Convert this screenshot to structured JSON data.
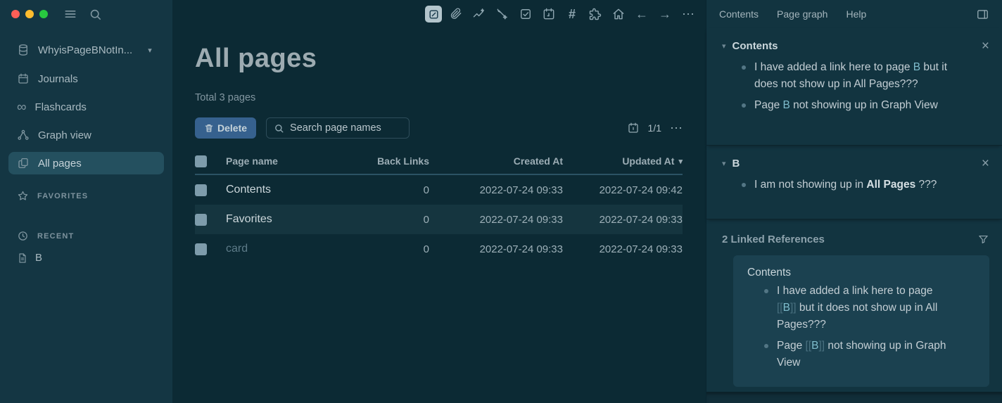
{
  "glyphs": {
    "caret_down": "▾",
    "close": "×",
    "ellipsis": "⋯",
    "arrow_left": "←",
    "arrow_right": "→",
    "hash": "#",
    "infinity": "∞"
  },
  "colors": {
    "left_sidebar_bg": "#143643",
    "main_bg": "#0c2a34",
    "right_sidebar_bg": "#123440",
    "card_bg": "#1b4150",
    "selected_item_bg": "#24505f",
    "delete_button_bg": "#36618e",
    "link_teal": "#7fbdcd",
    "traffic_red": "#ff5f57",
    "traffic_yellow": "#febc2e",
    "traffic_green": "#28c840"
  },
  "left_sidebar": {
    "graph_switcher": {
      "label": "WhyisPageBNotIn...",
      "icon": "database-icon"
    },
    "nav_items": [
      {
        "label": "Journals",
        "icon": "calendar-icon"
      },
      {
        "label": "Flashcards",
        "icon": "infinity-icon"
      },
      {
        "label": "Graph view",
        "icon": "graph-icon"
      },
      {
        "label": "All pages",
        "icon": "pages-icon"
      }
    ],
    "favorites_label": "FAVORITES",
    "recent_label": "RECENT",
    "recent_items": [
      {
        "label": "B",
        "icon": "document-icon"
      }
    ]
  },
  "toolbar": {
    "icons": [
      "edit-icon",
      "paperclip-icon",
      "activity-icon",
      "draw-icon",
      "task-icon",
      "calendar-icon",
      "hash-icon",
      "plugins-icon",
      "home-icon",
      "back-icon",
      "forward-icon",
      "more-icon"
    ]
  },
  "main": {
    "title": "All pages",
    "subtitle": "Total 3 pages",
    "delete_button": "Delete",
    "search_placeholder": "Search page names",
    "page_indicator": "1/1",
    "table": {
      "headers": {
        "name": "Page name",
        "back_links": "Back Links",
        "created": "Created At",
        "updated": "Updated At"
      },
      "rows": [
        {
          "name": "Contents",
          "back_links": "0",
          "created": "2022-07-24 09:33",
          "updated": "2022-07-24 09:42"
        },
        {
          "name": "Favorites",
          "back_links": "0",
          "created": "2022-07-24 09:33",
          "updated": "2022-07-24 09:33"
        },
        {
          "name": "card",
          "back_links": "0",
          "created": "2022-07-24 09:33",
          "updated": "2022-07-24 09:33"
        }
      ]
    }
  },
  "right_sidebar": {
    "tabs": [
      {
        "label": "Contents"
      },
      {
        "label": "Page graph"
      },
      {
        "label": "Help"
      }
    ],
    "contents_section": {
      "title": "Contents",
      "bullets": [
        {
          "pre": "I have added a link here to page ",
          "link": "B",
          "post": " but it does not show up in All Pages???"
        },
        {
          "pre": "Page ",
          "link": "B",
          "post": " not showing up in Graph View"
        }
      ]
    },
    "b_section": {
      "title": "B",
      "bullets": [
        {
          "pre": "I am not showing up in ",
          "bold": "All Pages",
          "post": " ???"
        }
      ]
    },
    "linked_references": {
      "title": "2 Linked References",
      "card": {
        "page_title": "Contents",
        "bullets": [
          {
            "pre": "I have added a link here to page ",
            "bracket_open": "[[",
            "link": "B",
            "bracket_close": "]]",
            "post": " but it does not show up in All Pages???"
          },
          {
            "pre": "Page ",
            "bracket_open": "[[",
            "link": "B",
            "bracket_close": "]]",
            "post": " not showing up in Graph View"
          }
        ]
      }
    }
  }
}
